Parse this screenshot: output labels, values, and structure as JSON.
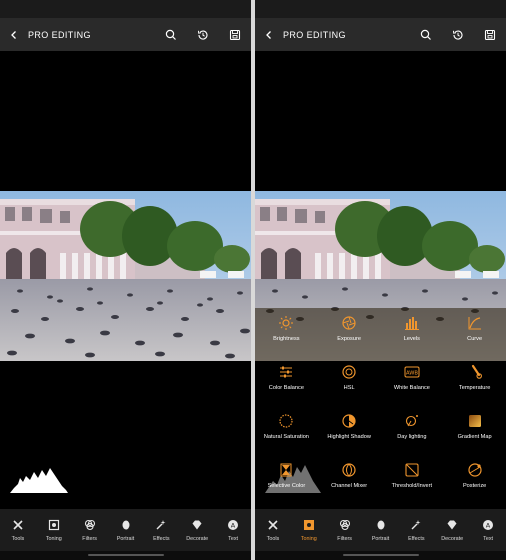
{
  "header": {
    "title": "PRO EDITING"
  },
  "toolbar_items": [
    {
      "label": "Tools",
      "icon": "tools-icon"
    },
    {
      "label": "Toning",
      "icon": "toning-icon"
    },
    {
      "label": "Filters",
      "icon": "filters-icon"
    },
    {
      "label": "Portrait",
      "icon": "portrait-icon"
    },
    {
      "label": "Effects",
      "icon": "effects-icon"
    },
    {
      "label": "Decorate",
      "icon": "decorate-icon"
    },
    {
      "label": "Text",
      "icon": "text-icon"
    }
  ],
  "active_tool_right": "Toning",
  "accent_color": "#f0962e",
  "toning_options": [
    {
      "label": "Brightness",
      "icon": "sun-icon"
    },
    {
      "label": "Exposure",
      "icon": "aperture-icon"
    },
    {
      "label": "Levels",
      "icon": "levels-icon"
    },
    {
      "label": "Curve",
      "icon": "curve-icon"
    },
    {
      "label": "Color Balance",
      "icon": "sliders-icon"
    },
    {
      "label": "HSL",
      "icon": "hsl-icon"
    },
    {
      "label": "White Balance",
      "icon": "awb-icon"
    },
    {
      "label": "Temperature",
      "icon": "thermometer-icon"
    },
    {
      "label": "Natural Saturation",
      "icon": "saturation-icon"
    },
    {
      "label": "Highlight Shadow",
      "icon": "highlight-shadow-icon"
    },
    {
      "label": "Day lighting",
      "icon": "daylight-icon"
    },
    {
      "label": "Gradient Map",
      "icon": "gradient-icon"
    },
    {
      "label": "Selective Color",
      "icon": "hourglass-icon"
    },
    {
      "label": "Channel Mixer",
      "icon": "channel-mixer-icon"
    },
    {
      "label": "Threshold/Invert",
      "icon": "threshold-icon"
    },
    {
      "label": "Posterize",
      "icon": "posterize-icon"
    }
  ]
}
